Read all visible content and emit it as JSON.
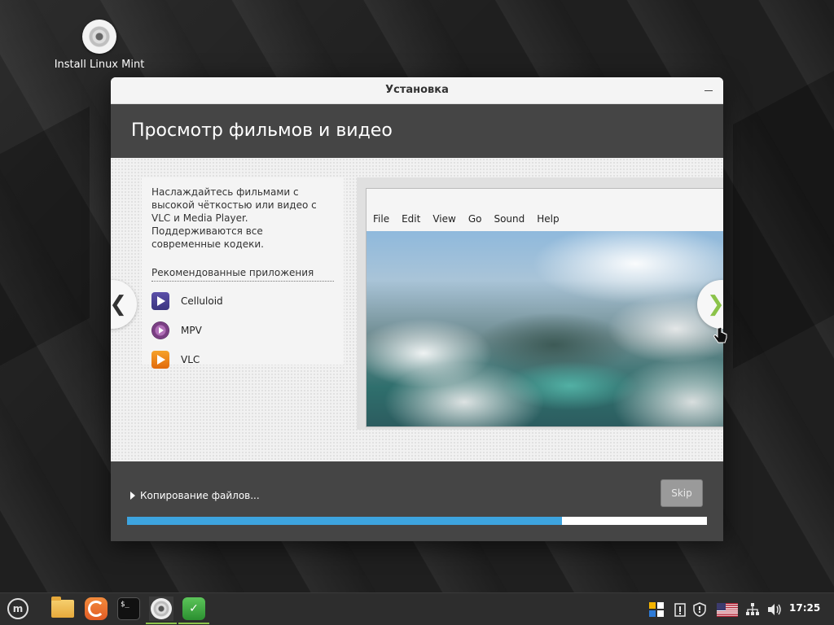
{
  "desktop": {
    "icon_label": "Install Linux Mint"
  },
  "window": {
    "title": "Установка",
    "header_title": "Просмотр фильмов и видео",
    "slide": {
      "description": "Наслаждайтесь фильмами с высокой чёткостью или видео с VLC и Media Player. Поддерживаются все современные кодеки.",
      "recommended_header": "Рекомендованные приложения",
      "apps": [
        {
          "name": "Celluloid",
          "icon": "celluloid-icon"
        },
        {
          "name": "MPV",
          "icon": "mpv-icon"
        },
        {
          "name": "VLC",
          "icon": "vlc-icon"
        }
      ],
      "player_menu": [
        "File",
        "Edit",
        "View",
        "Go",
        "Sound",
        "Help"
      ],
      "prev_glyph": "❮",
      "next_glyph": "❯"
    },
    "footer": {
      "status": "Копирование файлов...",
      "skip_label": "Skip",
      "progress_fraction": 0.75
    }
  },
  "taskbar": {
    "launchers": [
      "mint-menu-icon",
      "folder-icon",
      "firefox-icon",
      "terminal-icon",
      "disc-icon",
      "shield-app-icon"
    ],
    "clock": "17:25",
    "mint_glyph": "m",
    "terminal_glyph": "$_",
    "shield_glyph": "✓"
  },
  "colors": {
    "accent_blue": "#3da4df",
    "header_dark": "#454545",
    "mint_green": "#8bc34a"
  }
}
